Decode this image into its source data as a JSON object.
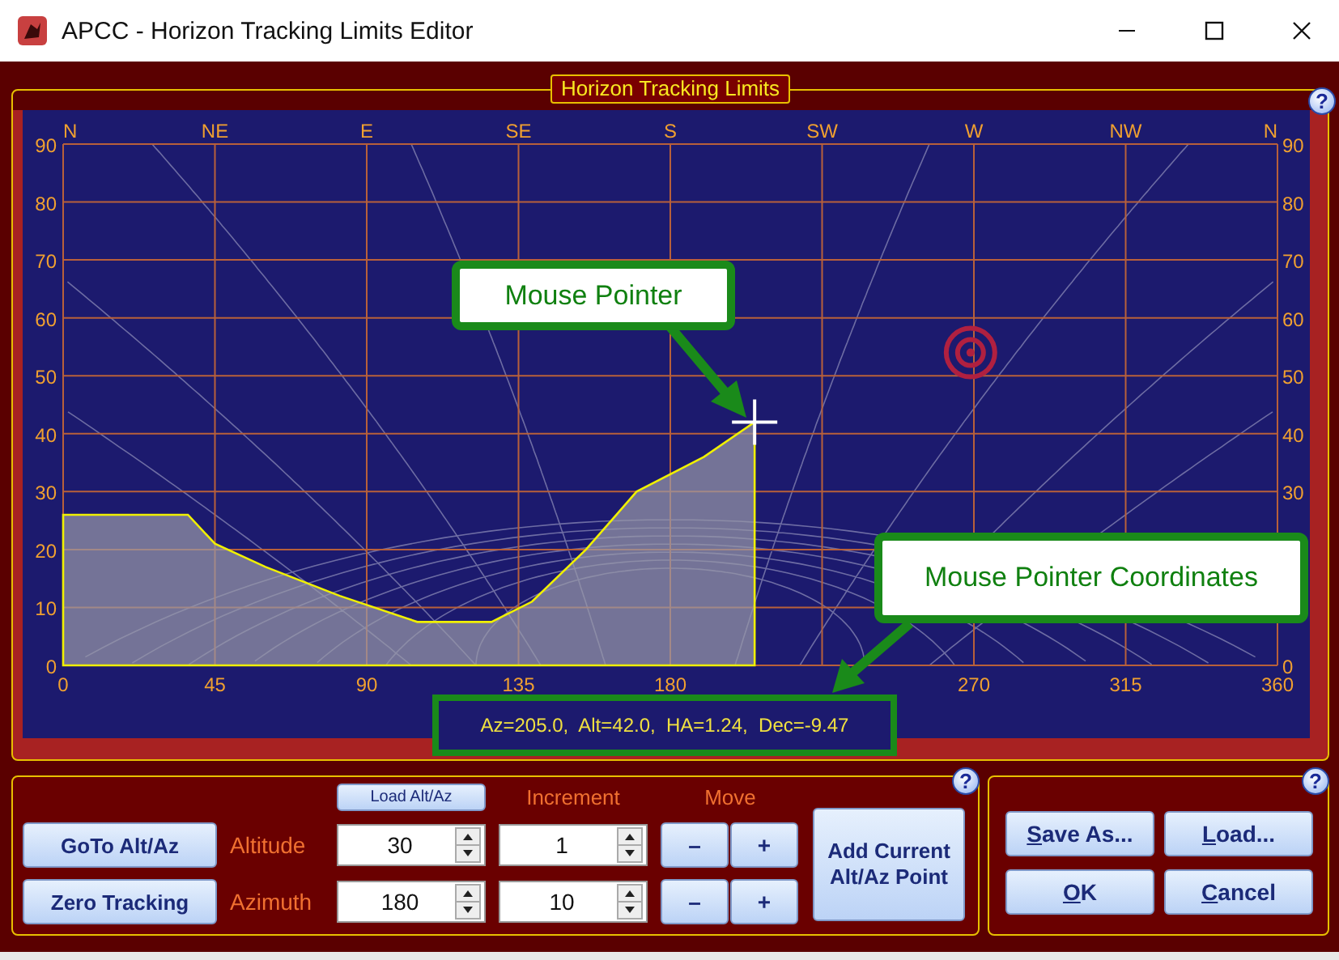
{
  "window": {
    "title": "APCC - Horizon Tracking Limits Editor"
  },
  "tracking_limits": {
    "title": "Horizon Tracking Limits",
    "help": "?",
    "compass_labels": [
      "N",
      "NE",
      "E",
      "SE",
      "S",
      "SW",
      "W",
      "NW",
      "N"
    ],
    "right_axis_ticks": [
      "90",
      "80",
      "70",
      "60",
      "50",
      "40",
      "30",
      "0"
    ],
    "chart_data": {
      "type": "area",
      "x": [
        0,
        0,
        37,
        45,
        60,
        82,
        105,
        127,
        139,
        155,
        170,
        190,
        205,
        205
      ],
      "values": [
        0,
        26,
        26,
        21,
        17,
        12,
        7.5,
        7.5,
        11,
        20,
        30,
        36,
        42,
        0
      ],
      "xlim": [
        0,
        360
      ],
      "ylim": [
        0,
        90
      ],
      "xticks": [
        0,
        45,
        90,
        135,
        180,
        270,
        315,
        360
      ],
      "yticks": [
        0,
        10,
        20,
        30,
        40,
        50,
        60,
        70,
        80,
        90
      ],
      "grid": true
    },
    "readout": "Az=205.0,  Alt=42.0,  HA=1.24,  Dec=-9.47",
    "callouts": [
      {
        "text": "Mouse Pointer"
      },
      {
        "text": "Mouse Pointer Coordinates"
      }
    ]
  },
  "controls": {
    "help": "?",
    "goto_button": "GoTo Alt/Az",
    "zero_button": "Zero Tracking",
    "load_button": "Load Alt/Az",
    "increment_header": "Increment",
    "move_header": "Move",
    "rows": [
      {
        "label": "Altitude",
        "value": "30",
        "increment": "1",
        "minus": "–",
        "plus": "+"
      },
      {
        "label": "Azimuth",
        "value": "180",
        "increment": "10",
        "minus": "–",
        "plus": "+"
      }
    ],
    "add_button": "Add Current Alt/Az Point"
  },
  "file_actions": {
    "help": "?",
    "buttons": [
      "Save As...",
      "Load...",
      "OK",
      "Cancel"
    ]
  }
}
